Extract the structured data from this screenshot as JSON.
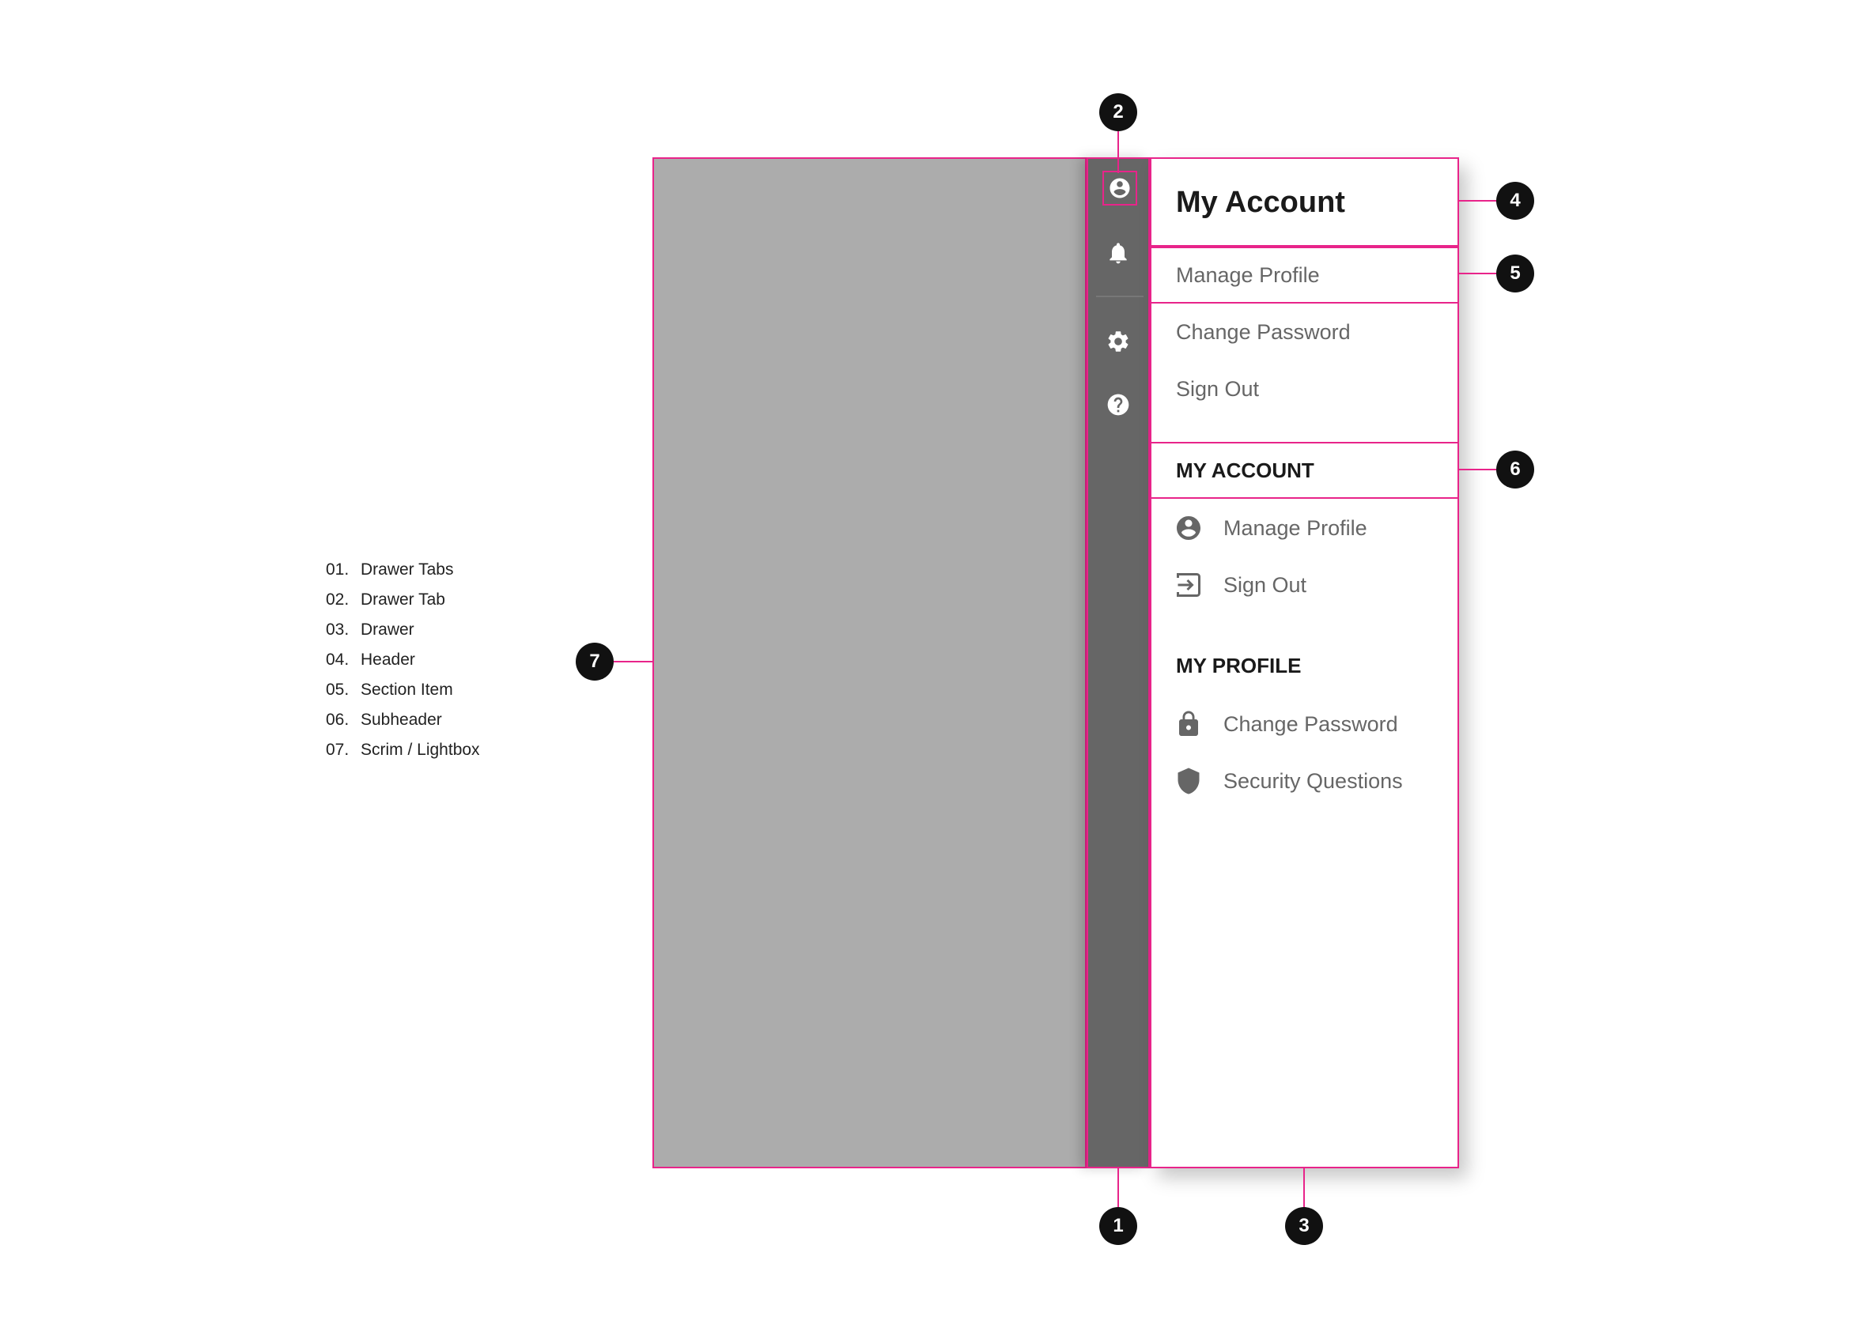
{
  "legend": [
    {
      "num": "01.",
      "label": "Drawer Tabs"
    },
    {
      "num": "02.",
      "label": "Drawer Tab"
    },
    {
      "num": "03.",
      "label": "Drawer"
    },
    {
      "num": "04.",
      "label": "Header"
    },
    {
      "num": "05.",
      "label": "Section Item"
    },
    {
      "num": "06.",
      "label": "Subheader"
    },
    {
      "num": "07.",
      "label": "Scrim / Lightbox"
    }
  ],
  "tabs": [
    {
      "icon": "account-circle-icon",
      "selected": true
    },
    {
      "icon": "bell-icon",
      "selected": false
    },
    {
      "icon": "gear-icon",
      "selected": false
    },
    {
      "icon": "help-circle-icon",
      "selected": false
    }
  ],
  "drawer": {
    "title": "My Account",
    "section_items": [
      "Manage Profile",
      "Change Password",
      "Sign Out"
    ],
    "groups": [
      {
        "subheader": "MY ACCOUNT",
        "items": [
          {
            "label": "Manage Profile",
            "icon": "account-circle-icon"
          },
          {
            "label": "Sign Out",
            "icon": "sign-out-icon"
          }
        ]
      },
      {
        "subheader": "MY PROFILE",
        "items": [
          {
            "label": "Change Password",
            "icon": "lock-icon"
          },
          {
            "label": "Security Questions",
            "icon": "shield-icon"
          }
        ]
      }
    ]
  },
  "callouts": [
    "1",
    "2",
    "3",
    "4",
    "5",
    "6",
    "7"
  ],
  "colors": {
    "annotation": "#e8248a",
    "scrim": "#acacac",
    "tabs_bg": "#666666",
    "tab_icon": "#ffffff",
    "item_text": "#666666",
    "heading_text": "#1a1a1a",
    "callout_bg": "#111111"
  }
}
